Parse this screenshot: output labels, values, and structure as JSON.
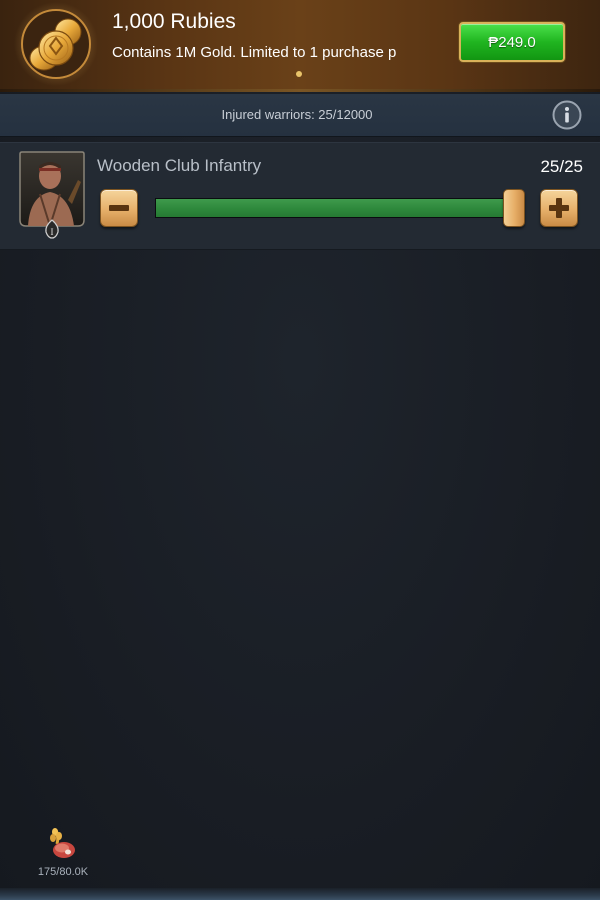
{
  "promo": {
    "title": "1,000 Rubies",
    "subtitle": "Contains 1M Gold. Limited to 1 purchase p",
    "price_label": "₱249.0",
    "icon": "gold-coins-icon"
  },
  "injured": {
    "label": "Injured warriors: 25/12000",
    "info_icon": "info-icon"
  },
  "troop": {
    "name": "Wooden Club Infantry",
    "count_label": "25/25",
    "tier": "I",
    "slider_fraction": 1.0,
    "minus_icon": "minus-icon",
    "plus_icon": "plus-icon"
  },
  "resources": {
    "food_label": "175/80.0K",
    "food_icon": "food-icon"
  },
  "colors": {
    "accent_gold": "#e6b06a",
    "buy_green": "#20b520",
    "slider_green": "#2f8a3d",
    "background": "#1a1f26"
  }
}
